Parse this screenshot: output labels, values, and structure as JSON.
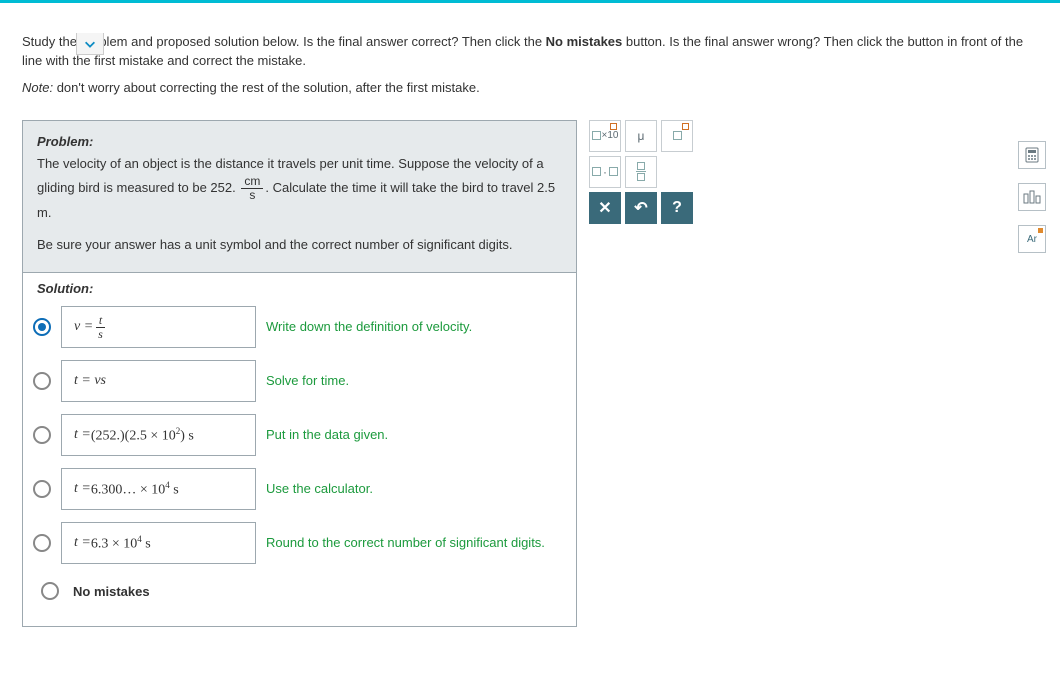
{
  "instructions": {
    "line1_a": "Study the problem and proposed solution below. Is the final answer correct? Then click the ",
    "bold1": "No mistakes",
    "line1_b": " button. Is the final answer wrong? Then click the button in front of the line with the first mistake and correct the mistake.",
    "note_prefix": "Note:",
    "note_text": " don't worry about correcting the rest of the solution, after the first mistake."
  },
  "problem": {
    "label": "Problem:",
    "text_a": "The velocity of an object is the distance it travels per unit time. Suppose the velocity of a gliding bird is measured to be 252. ",
    "unit_num": "cm",
    "unit_den": "s",
    "text_b": ". Calculate the time it will take the bird to travel 2.5 m.",
    "text_c": "Be sure your answer has a unit symbol and the correct number of significant digits."
  },
  "solution": {
    "label": "Solution:",
    "steps": [
      {
        "equation_html": "v = <span class='frac'><span class='num'>t</span><span class='den'>s</span></span>",
        "explain": "Write down the definition of velocity.",
        "selected": true
      },
      {
        "equation_html": "t = vs",
        "explain": "Solve for time.",
        "selected": false
      },
      {
        "equation_html": "t = <span class='up'>(252.)(2.5 × 10<sup>2</sup>) s</span>",
        "explain": "Put in the data given.",
        "selected": false
      },
      {
        "equation_html": "t = <span class='up'>6.300… × 10<sup>4</sup> s</span>",
        "explain": "Use the calculator.",
        "selected": false
      },
      {
        "equation_html": "t = <span class='up'>6.3 × 10<sup>4</sup> s</span>",
        "explain": "Round to the correct number of significant digits.",
        "selected": false
      }
    ],
    "no_mistakes": "No mistakes"
  },
  "toolbar": {
    "btn_x10": "×10",
    "btn_mu": "μ",
    "btn_dot": "·",
    "btn_close": "✕",
    "btn_undo": "↶",
    "btn_help": "?"
  },
  "side": {
    "calc": "calculator-icon",
    "ruler": "measurement-icon",
    "table": "periodic-table-icon"
  }
}
